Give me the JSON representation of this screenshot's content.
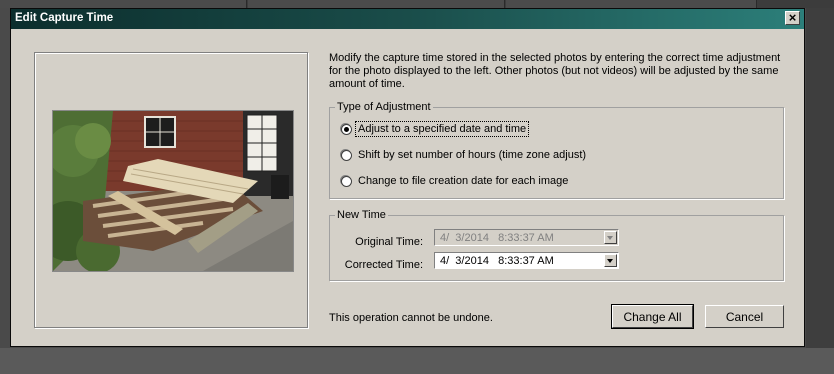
{
  "dialog": {
    "title": "Edit Capture Time",
    "close_label": "×",
    "description": "Modify the capture time stored in the selected photos by entering the correct time adjustment for the photo displayed to the left. Other photos (but not videos) will be adjusted by the same amount of time."
  },
  "adjustment": {
    "legend": "Type of Adjustment",
    "options": [
      {
        "label": "Adjust to a specified date and time",
        "selected": true
      },
      {
        "label": "Shift by set number of hours (time zone adjust)",
        "selected": false
      },
      {
        "label": "Change to file creation date for each image",
        "selected": false
      }
    ]
  },
  "new_time": {
    "legend": "New Time",
    "original_label": "Original Time:",
    "original_value": "4/  3/2014   8:33:37 AM",
    "corrected_label": "Corrected Time:",
    "corrected_value": "4/  3/2014   8:33:37 AM"
  },
  "footer": {
    "note": "This operation cannot be undone.",
    "change_all": "Change All",
    "cancel": "Cancel"
  },
  "colors": {
    "title_gradient_start": "#0c2e2d",
    "title_gradient_end": "#2c7f7a",
    "dialog_bg": "#d4d0c8"
  }
}
